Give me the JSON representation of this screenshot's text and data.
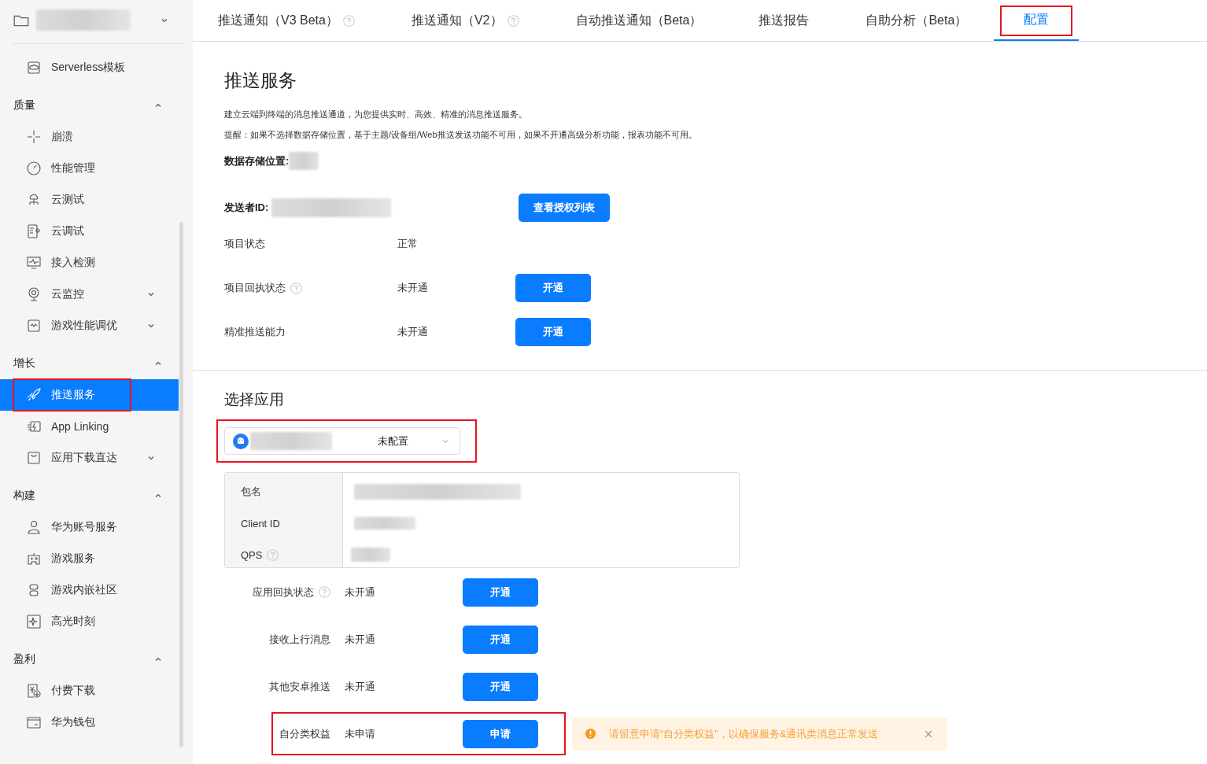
{
  "sidebar": {
    "sections": [
      {
        "items": [
          {
            "label": "Serverless模板",
            "expandable": false,
            "selected": false,
            "highlighted": false
          }
        ]
      },
      {
        "title": "质量",
        "expanded": true,
        "items": [
          {
            "label": "崩溃",
            "expandable": false,
            "selected": false,
            "highlighted": false
          },
          {
            "label": "性能管理",
            "expandable": false,
            "selected": false,
            "highlighted": false
          },
          {
            "label": "云测试",
            "expandable": false,
            "selected": false,
            "highlighted": false
          },
          {
            "label": "云调试",
            "expandable": false,
            "selected": false,
            "highlighted": false
          },
          {
            "label": "接入检测",
            "expandable": false,
            "selected": false,
            "highlighted": false
          },
          {
            "label": "云监控",
            "expandable": true,
            "selected": false,
            "highlighted": false
          },
          {
            "label": "游戏性能调优",
            "expandable": true,
            "selected": false,
            "highlighted": false
          }
        ]
      },
      {
        "title": "增长",
        "expanded": true,
        "items": [
          {
            "label": "推送服务",
            "expandable": false,
            "selected": true,
            "highlighted": true
          },
          {
            "label": "App Linking",
            "expandable": false,
            "selected": false,
            "highlighted": false
          },
          {
            "label": "应用下载直达",
            "expandable": true,
            "selected": false,
            "highlighted": false
          }
        ]
      },
      {
        "title": "构建",
        "expanded": true,
        "items": [
          {
            "label": "华为账号服务",
            "expandable": false,
            "selected": false,
            "highlighted": false
          },
          {
            "label": "游戏服务",
            "expandable": false,
            "selected": false,
            "highlighted": false
          },
          {
            "label": "游戏内嵌社区",
            "expandable": false,
            "selected": false,
            "highlighted": false
          },
          {
            "label": "高光时刻",
            "expandable": false,
            "selected": false,
            "highlighted": false
          }
        ]
      },
      {
        "title": "盈利",
        "expanded": true,
        "items": [
          {
            "label": "付费下载",
            "expandable": false,
            "selected": false,
            "highlighted": false
          },
          {
            "label": "华为钱包",
            "expandable": false,
            "selected": false,
            "highlighted": false
          }
        ]
      }
    ]
  },
  "tabs": [
    {
      "label": "推送通知（V3 Beta）",
      "help": true,
      "selected": false,
      "highlighted": false
    },
    {
      "label": "推送通知（V2）",
      "help": true,
      "selected": false,
      "highlighted": false
    },
    {
      "label": "自动推送通知（Beta）",
      "help": false,
      "selected": false,
      "highlighted": false
    },
    {
      "label": "推送报告",
      "help": false,
      "selected": false,
      "highlighted": false
    },
    {
      "label": "自助分析（Beta）",
      "help": false,
      "selected": false,
      "highlighted": false
    },
    {
      "label": "配置",
      "help": false,
      "selected": true,
      "highlighted": true
    }
  ],
  "service": {
    "title": "推送服务",
    "description": "建立云端到终端的消息推送通道，为您提供实时、高效、精准的消息推送服务。",
    "notice": "提醒：如果不选择数据存储位置，基于主题/设备组/Web推送发送功能不可用，如果不开通高级分析功能，报表功能不可用。",
    "storage_label": "数据存储位置:",
    "sender_label": "发送者ID:",
    "auth_button": "查看授权列表",
    "rows": [
      {
        "label": "项目状态",
        "help": false,
        "status": "正常",
        "button": null
      },
      {
        "label": "项目回执状态",
        "help": true,
        "status": "未开通",
        "button": "开通"
      },
      {
        "label": "精准推送能力",
        "help": false,
        "status": "未开通",
        "button": "开通"
      }
    ]
  },
  "app_section": {
    "title": "选择应用",
    "select": {
      "status": "未配置",
      "highlighted": true
    },
    "info": [
      {
        "label": "包名",
        "help": false
      },
      {
        "label": "Client ID",
        "help": false
      },
      {
        "label": "QPS",
        "help": true
      }
    ],
    "rows": [
      {
        "label": "应用回执状态",
        "help": true,
        "status": "未开通",
        "button": "开通",
        "highlighted": false
      },
      {
        "label": "接收上行消息",
        "help": false,
        "status": "未开通",
        "button": "开通",
        "highlighted": false
      },
      {
        "label": "其他安卓推送",
        "help": false,
        "status": "未开通",
        "button": "开通",
        "highlighted": false
      },
      {
        "label": "自分类权益",
        "help": false,
        "status": "未申请",
        "button": "申请",
        "highlighted": true
      }
    ],
    "alert": {
      "text": "请留意申请“自分类权益”，以确保服务&通讯类消息正常发送"
    }
  }
}
